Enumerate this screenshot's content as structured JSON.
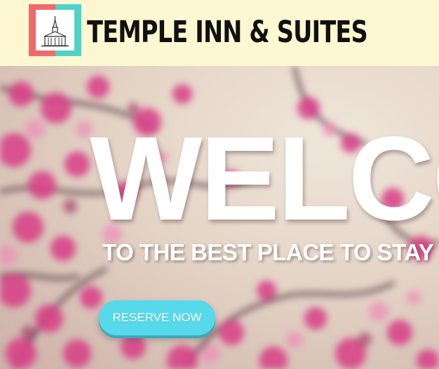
{
  "header": {
    "title": "TEMPLE INN & SUITES",
    "logo_colors": {
      "left": "#f06a6a",
      "right": "#4fd3c8"
    },
    "background": "#fdf8d2"
  },
  "hero": {
    "headline": "WELCOME",
    "tagline": "TO THE BEST PLACE TO STAY",
    "cta_label": "RESERVE NOW",
    "cta_color": "#57d9ec"
  }
}
